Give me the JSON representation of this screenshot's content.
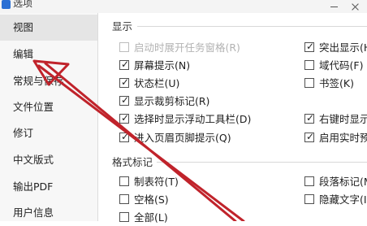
{
  "window": {
    "title": "选项",
    "icon": "app-icon"
  },
  "sidebar": {
    "items": [
      {
        "label": "视图",
        "active": true
      },
      {
        "label": "编辑",
        "active": false
      },
      {
        "label": "常规与保存",
        "active": false
      },
      {
        "label": "文件位置",
        "active": false
      },
      {
        "label": "修订",
        "active": false
      },
      {
        "label": "中文版式",
        "active": false
      },
      {
        "label": "输出PDF",
        "active": false
      },
      {
        "label": "用户信息",
        "active": false
      }
    ]
  },
  "display": {
    "title": "显示",
    "left": [
      {
        "label": "启动时展开任务窗格(R)",
        "checked": false,
        "disabled": true
      },
      {
        "label": "屏幕提示(N)",
        "checked": true,
        "disabled": false
      },
      {
        "label": "状态栏(U)",
        "checked": true,
        "disabled": false
      },
      {
        "label": "显示裁剪标记(R)",
        "checked": true,
        "disabled": false
      },
      {
        "label": "选择时显示浮动工具栏(D)",
        "checked": true,
        "disabled": false
      },
      {
        "label": "进入页眉页脚提示(Q)",
        "checked": true,
        "disabled": false
      }
    ],
    "right": [
      {
        "label": "突出显示(H)",
        "checked": true,
        "disabled": false
      },
      {
        "label": "域代码(F)",
        "checked": false,
        "disabled": false
      },
      {
        "label": "书签(K)",
        "checked": false,
        "disabled": false
      },
      {
        "label": "",
        "checked": false,
        "disabled": false
      },
      {
        "label": "右键时显示",
        "checked": true,
        "disabled": false
      },
      {
        "label": "启用实时预",
        "checked": true,
        "disabled": false
      }
    ]
  },
  "format_marks": {
    "title": "格式标记",
    "left": [
      {
        "label": "制表符(T)",
        "checked": false
      },
      {
        "label": "空格(S)",
        "checked": false
      },
      {
        "label": "全部(L)",
        "checked": false
      }
    ],
    "right": [
      {
        "label": "段落标记(M)",
        "checked": false
      },
      {
        "label": "隐藏文字(I)",
        "checked": false
      }
    ]
  },
  "annotation": {
    "color": "#c0232b",
    "icon": "red-arrow-annotation"
  }
}
